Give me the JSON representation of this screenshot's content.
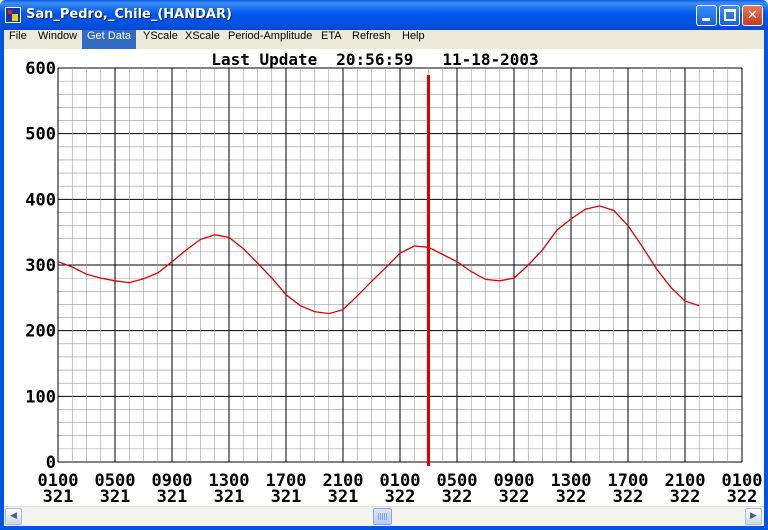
{
  "window": {
    "title": "San_Pedro,_Chile_(HANDAR)",
    "controls": {
      "minimize": "minimize-icon",
      "maximize": "maximize-icon",
      "close": "close-icon"
    }
  },
  "menu": [
    {
      "label": "File"
    },
    {
      "label": "Window"
    },
    {
      "label": "Get Data",
      "active": true
    },
    {
      "label": "YScale"
    },
    {
      "label": "XScale"
    },
    {
      "label": "Period-Amplitude"
    },
    {
      "label": "ETA"
    },
    {
      "label": "Refresh"
    },
    {
      "label": "Help"
    }
  ],
  "status": {
    "last_update_label": "Last Update",
    "time": "20:56:59",
    "date": "11-18-2003"
  },
  "colors": {
    "line": "#e00000",
    "marker": "#e00000",
    "grid": "#000000"
  },
  "chart_data": {
    "type": "line",
    "ylim": [
      0,
      600
    ],
    "yticks": [
      0,
      100,
      200,
      300,
      400,
      500,
      600
    ],
    "xlim": [
      0,
      48
    ],
    "xtick_hours": [
      0,
      4,
      8,
      12,
      16,
      20,
      24,
      28,
      32,
      36,
      40,
      44,
      48
    ],
    "xtick_labels": [
      "0100",
      "0500",
      "0900",
      "1300",
      "1700",
      "2100",
      "0100",
      "0500",
      "0900",
      "1300",
      "1700",
      "2100",
      "0100"
    ],
    "xtick_days": [
      "321",
      "321",
      "321",
      "321",
      "321",
      "321",
      "322",
      "322",
      "322",
      "322",
      "322",
      "322",
      "322"
    ],
    "current_time_marker_hours": 26.0,
    "series": [
      {
        "x": [
          0,
          1,
          2,
          3,
          4,
          5,
          6,
          7,
          8,
          9,
          10,
          11,
          12,
          13,
          14,
          15,
          16,
          17,
          18,
          19,
          20,
          21,
          22,
          23,
          24,
          25,
          26,
          27,
          28,
          29,
          30,
          31,
          32,
          33,
          34,
          35,
          36,
          37,
          38,
          39,
          40,
          41,
          42,
          43,
          44,
          45
        ],
        "y": [
          305,
          297,
          286,
          280,
          276,
          273,
          279,
          288,
          305,
          323,
          339,
          346,
          342,
          325,
          303,
          280,
          255,
          238,
          229,
          226,
          232,
          253,
          275,
          296,
          318,
          329,
          327,
          316,
          305,
          290,
          278,
          276,
          280,
          300,
          323,
          353,
          370,
          385,
          390,
          383,
          360,
          328,
          294,
          266,
          245,
          238
        ]
      }
    ]
  }
}
